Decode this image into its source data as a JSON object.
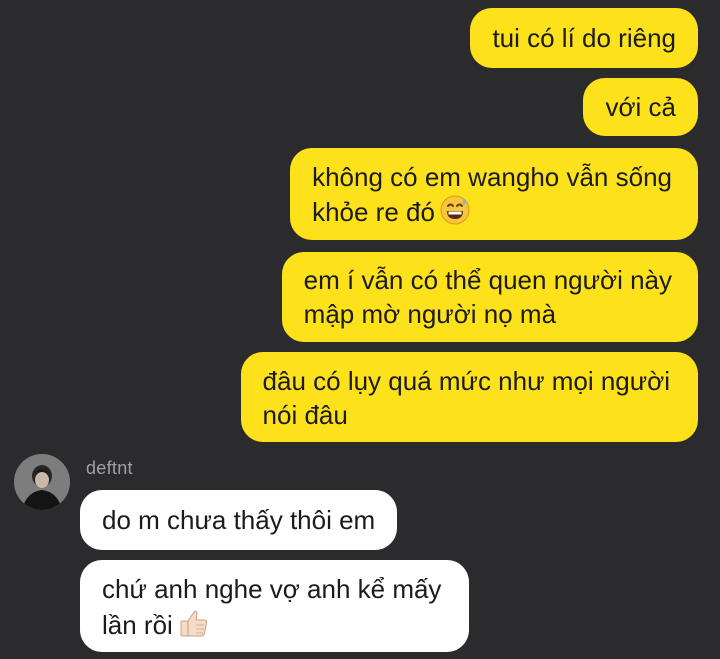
{
  "conversation": {
    "outgoing": [
      {
        "lines": [
          "tui có lí do riêng"
        ]
      },
      {
        "lines": [
          "với cả"
        ]
      },
      {
        "lines": [
          "không có em wangho vẫn sống",
          "khỏe re đó"
        ],
        "emoji": "grinning-sweat-emoji"
      },
      {
        "lines": [
          "em í vẫn có thể quen người này",
          "mập mờ người nọ mà"
        ]
      },
      {
        "lines": [
          "đâu có lụy quá mức như mọi người",
          "nói đâu"
        ]
      }
    ],
    "incoming": {
      "sender": "deftnt",
      "messages": [
        {
          "lines": [
            "do m chưa thấy thôi em"
          ]
        },
        {
          "lines": [
            "chứ anh nghe vợ anh kể mấy",
            "lần rồi"
          ],
          "emoji": "thumbs-up-emoji"
        }
      ]
    }
  },
  "colors": {
    "background": "#2b2b2d",
    "outgoing_bubble": "#fde21b",
    "incoming_bubble": "#ffffff",
    "sender_name": "#a0a0a4"
  }
}
